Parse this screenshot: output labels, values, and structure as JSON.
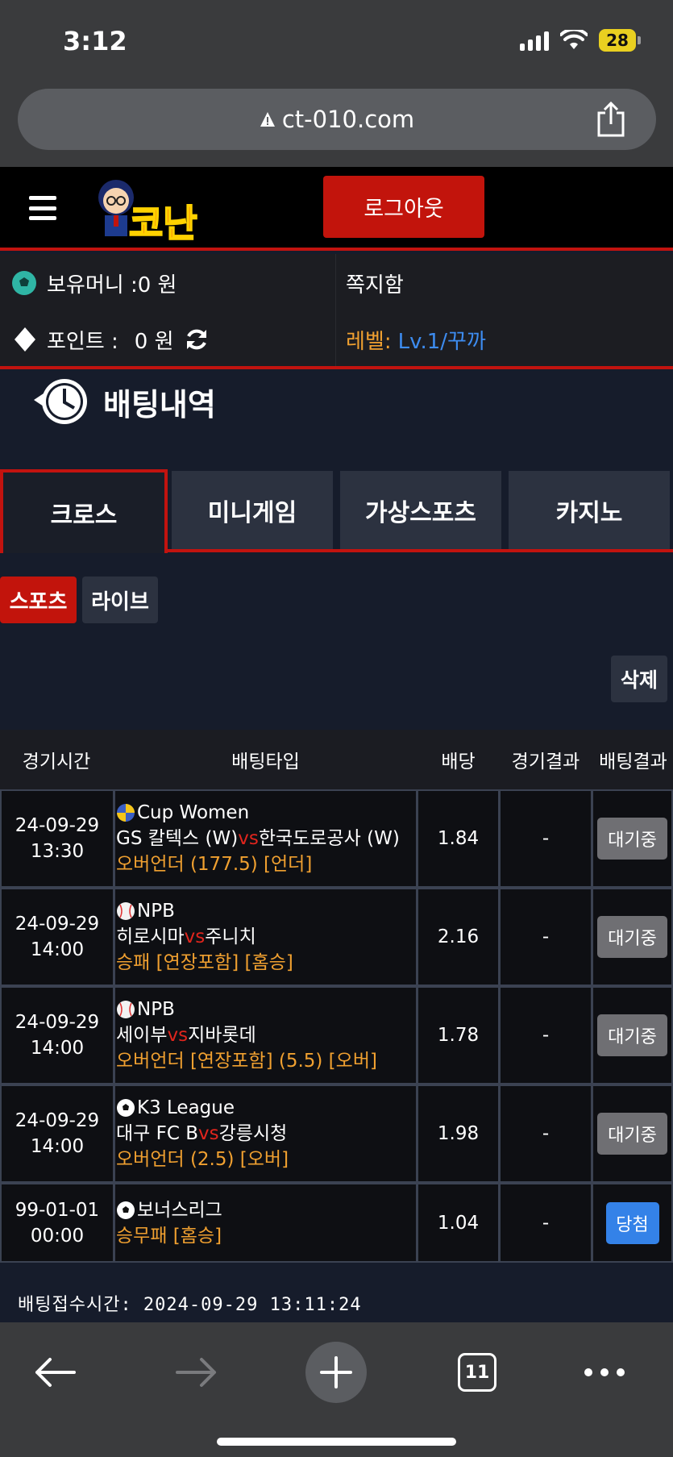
{
  "status_bar": {
    "time": "3:12",
    "battery": "28"
  },
  "browser": {
    "url": "ct-010.com",
    "tab_count": "11"
  },
  "header": {
    "logo_text": "코난",
    "logout_label": "로그아웃"
  },
  "account": {
    "money_label": "보유머니 :0 원",
    "point_label": "포인트 :",
    "point_value": "0 원",
    "message_label": "쪽지함",
    "level_label": "레벨:",
    "level_value": "Lv.1/꾸까"
  },
  "page_title": "배팅내역",
  "tabs": [
    "크로스",
    "미니게임",
    "가상스포츠",
    "카지노"
  ],
  "subtabs": [
    "스포츠",
    "라이브"
  ],
  "delete_label": "삭제",
  "table": {
    "headers": [
      "경기시간",
      "배팅타입",
      "배당",
      "경기결과",
      "배팅결과"
    ],
    "rows": [
      {
        "date": "24-09-29",
        "time": "13:30",
        "sport_icon": "volleyball-icon",
        "league": "Cup Women",
        "home": "GS 칼텍스 (W)",
        "vs": "vs",
        "away": "한국도로공사 (W)",
        "pick": "오버언더 (177.5) [언더]",
        "odds": "1.84",
        "result": "-",
        "status": "대기중"
      },
      {
        "date": "24-09-29",
        "time": "14:00",
        "sport_icon": "baseball-icon",
        "league": "NPB",
        "home": "히로시마",
        "vs": "vs",
        "away": "주니치",
        "pick": "승패 [연장포함] [홈승]",
        "odds": "2.16",
        "result": "-",
        "status": "대기중"
      },
      {
        "date": "24-09-29",
        "time": "14:00",
        "sport_icon": "baseball-icon",
        "league": "NPB",
        "home": "세이부",
        "vs": "vs",
        "away": "지바롯데",
        "pick": "오버언더 [연장포함] (5.5) [오버]",
        "odds": "1.78",
        "result": "-",
        "status": "대기중"
      },
      {
        "date": "24-09-29",
        "time": "14:00",
        "sport_icon": "soccer-icon",
        "league": "K3 League",
        "home": "대구 FC B",
        "vs": "vs",
        "away": "강릉시청",
        "pick": "오버언더 (2.5) [오버]",
        "odds": "1.98",
        "result": "-",
        "status": "대기중"
      },
      {
        "date": "99-01-01",
        "time": "00:00",
        "sport_icon": "soccer-icon",
        "league": "보너스리그",
        "home": "",
        "vs": "",
        "away": "",
        "pick": "승무패 [홈승]",
        "odds": "1.04",
        "result": "-",
        "status": "당첨"
      }
    ]
  },
  "receipt_time": "배팅접수시간: 2024-09-29 13:11:24",
  "colors": {
    "accent_red": "#c2130f",
    "pick_orange": "#f0a030",
    "win_blue": "#3482e8",
    "wait_gray": "#6f6f73"
  }
}
